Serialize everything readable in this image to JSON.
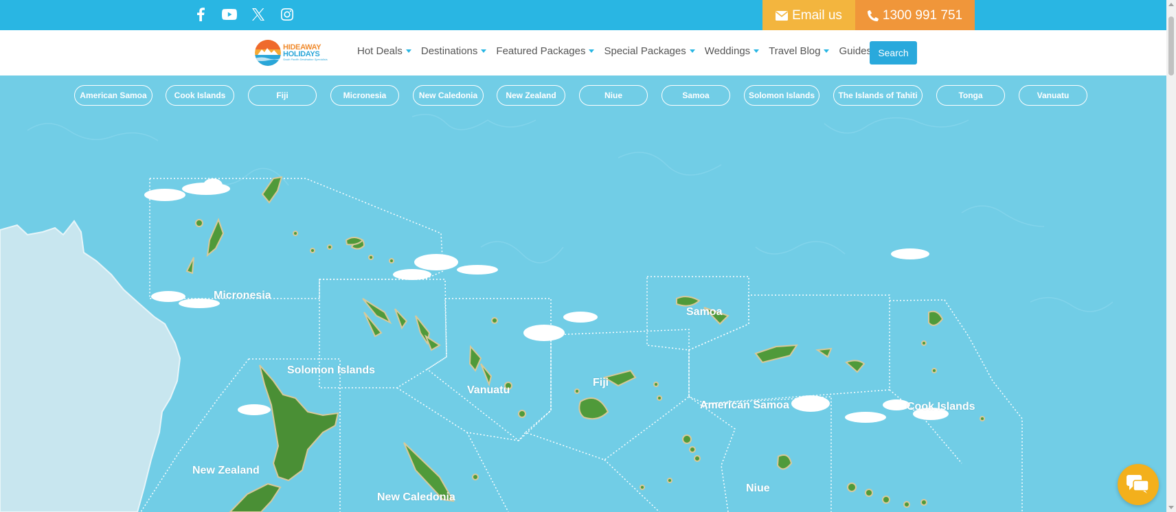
{
  "topbar": {
    "social_icons": [
      "facebook-icon",
      "youtube-icon",
      "x-icon",
      "instagram-icon"
    ],
    "email_label": "Email us",
    "phone_label": "1300 991 751",
    "colors": {
      "bar": "#29b6e3",
      "email": "#f3b53e",
      "phone": "#f0963a"
    }
  },
  "nav": {
    "logo": {
      "line1": "HIDEAWAY",
      "line2": "HOLIDAYS",
      "tagline": "South Pacific Destination Specialists"
    },
    "items": [
      {
        "label": "Hot Deals"
      },
      {
        "label": "Destinations"
      },
      {
        "label": "Featured Packages"
      },
      {
        "label": "Special Packages"
      },
      {
        "label": "Weddings"
      },
      {
        "label": "Travel Blog"
      },
      {
        "label": "Guides"
      }
    ],
    "search_label": "Search"
  },
  "map": {
    "pills": [
      {
        "label": "American Samoa"
      },
      {
        "label": "Cook Islands"
      },
      {
        "label": "Fiji"
      },
      {
        "label": "Micronesia"
      },
      {
        "label": "New Caledonia"
      },
      {
        "label": "New Zealand"
      },
      {
        "label": "Niue"
      },
      {
        "label": "Samoa"
      },
      {
        "label": "Solomon Islands"
      },
      {
        "label": "The Islands of Tahiti"
      },
      {
        "label": "Tonga"
      },
      {
        "label": "Vanuatu"
      }
    ],
    "regions": [
      {
        "label": "Micronesia"
      },
      {
        "label": "Solomon Islands"
      },
      {
        "label": "Vanuatu"
      },
      {
        "label": "Fiji"
      },
      {
        "label": "Samoa"
      },
      {
        "label": "American Samoa"
      },
      {
        "label": "Cook Islands"
      },
      {
        "label": "New Zealand"
      },
      {
        "label": "New Caledonia"
      },
      {
        "label": "Niue"
      }
    ],
    "colors": {
      "sea": "#71cde6",
      "land": "#4f9a3a",
      "australia": "#c9e7f0"
    }
  },
  "chat": {
    "icon": "chat-icon"
  }
}
